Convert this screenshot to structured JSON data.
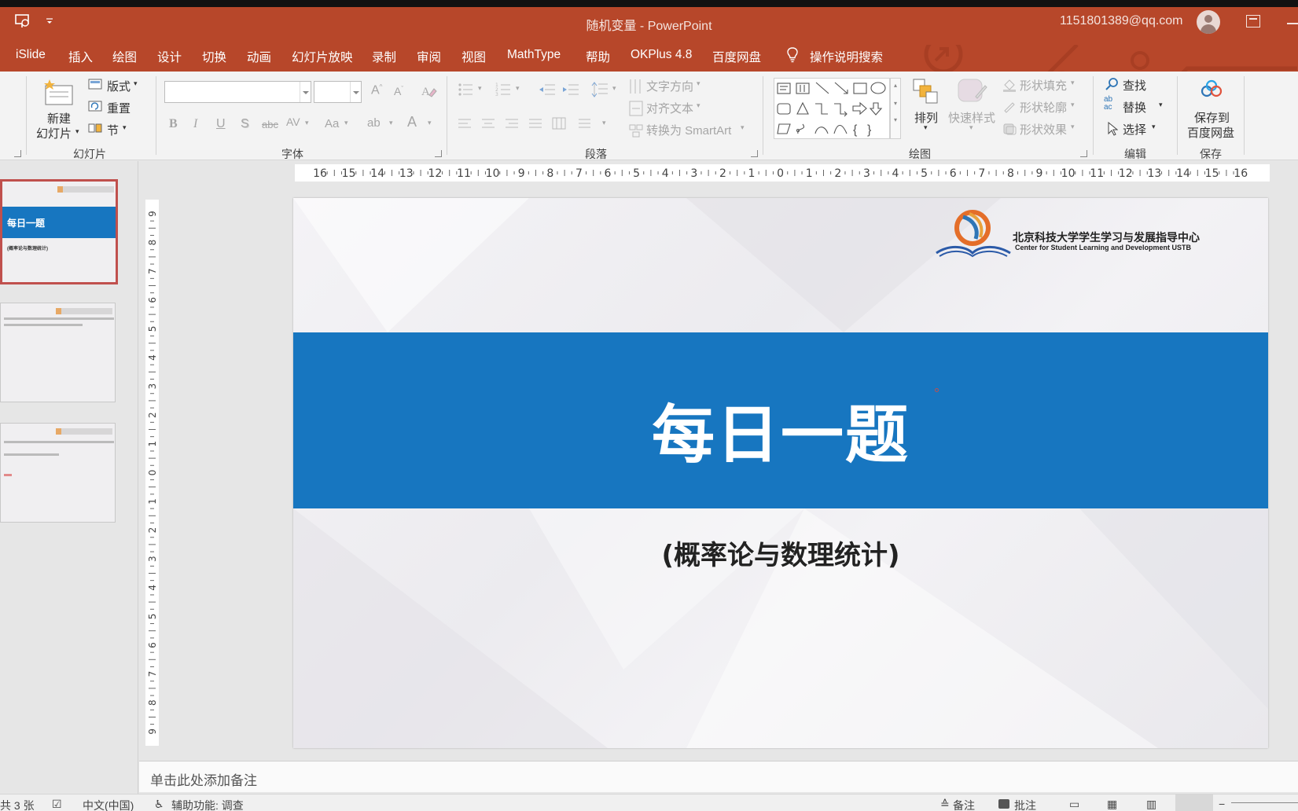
{
  "window": {
    "title": "随机变量 - PowerPoint",
    "user_email": "1151801389@qq.com"
  },
  "tabs": [
    "iSlide",
    "插入",
    "绘图",
    "设计",
    "切换",
    "动画",
    "幻灯片放映",
    "录制",
    "审阅",
    "视图",
    "MathType",
    "帮助",
    "OKPlus 4.8",
    "百度网盘",
    "操作说明搜索"
  ],
  "ribbon": {
    "slides_group": {
      "new_slide": "新建",
      "new_slide_2": "幻灯片",
      "layout": "版式",
      "reset": "重置",
      "section": "节",
      "label": "幻灯片"
    },
    "font_group": {
      "label": "字体",
      "font_name": "",
      "font_size": ""
    },
    "paragraph_group": {
      "label": "段落",
      "text_direction": "文字方向",
      "align_text": "对齐文本",
      "convert_smartart": "转换为 SmartArt"
    },
    "drawing_group": {
      "label": "绘图",
      "arrange": "排列",
      "quick_styles": "快速样式",
      "shape_fill": "形状填充",
      "shape_outline": "形状轮廓",
      "shape_effects": "形状效果"
    },
    "editing_group": {
      "label": "编辑",
      "find": "查找",
      "replace": "替换",
      "select": "选择"
    },
    "save_group": {
      "label": "保存",
      "save_to": "保存到",
      "baidu_disk": "百度网盘"
    }
  },
  "ruler": {
    "horizontal_ticks": [
      "16",
      "15",
      "14",
      "13",
      "12",
      "11",
      "10",
      "9",
      "8",
      "7",
      "6",
      "5",
      "4",
      "3",
      "2",
      "1",
      "0",
      "1",
      "2",
      "3",
      "4",
      "5",
      "6",
      "7",
      "8",
      "9",
      "10",
      "11",
      "12",
      "13",
      "14",
      "15",
      "16"
    ],
    "vertical_ticks": [
      "9",
      "8",
      "7",
      "6",
      "5",
      "4",
      "3",
      "2",
      "1",
      "0",
      "1",
      "2",
      "3",
      "4",
      "5",
      "6",
      "7",
      "8",
      "9"
    ]
  },
  "thumbnails": [
    {
      "title": "每日一题",
      "subtitle": "(概率论与数理统计)"
    },
    {
      "title": "",
      "subtitle": ""
    },
    {
      "title": "",
      "subtitle": ""
    }
  ],
  "slide": {
    "title": "每日一题",
    "subtitle": "(概率论与数理统计)",
    "logo_cn": "北京科技大学学生学习与发展指导中心",
    "logo_en": "Center for Student Learning and Development USTB"
  },
  "notes_placeholder": "单击此处添加备注",
  "status": {
    "slide_count": "共 3 张",
    "language": "中文(中国)",
    "accessibility": "辅助功能: 调查",
    "notes": "备注",
    "comments": "批注"
  },
  "colors": {
    "titlebar": "#b7472a",
    "slide_band": "#1776c0",
    "active_thumb_border": "#c0504d"
  }
}
